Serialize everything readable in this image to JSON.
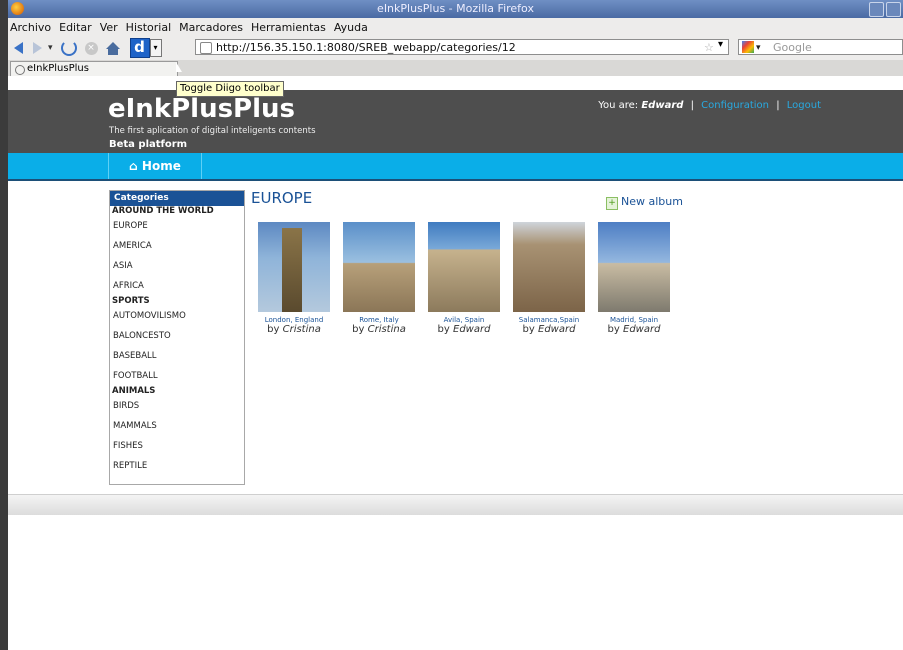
{
  "browser": {
    "title": "eInkPlusPlus - Mozilla Firefox",
    "menu": [
      "Archivo",
      "Editar",
      "Ver",
      "Historial",
      "Marcadores",
      "Herramientas",
      "Ayuda"
    ],
    "url": "http://156.35.150.1:8080/SREB_webapp/categories/12",
    "search_placeholder": "Google",
    "tab_title": "eInkPlusPlus",
    "tooltip": "Toggle Diigo toolbar"
  },
  "site": {
    "logo": "eInkPlusPlus",
    "tagline": "The first aplication of digital inteligents contents",
    "beta": "Beta platform",
    "user_prefix": "You are:",
    "user_name": "Edward",
    "config_label": "Configuration",
    "logout_label": "Logout",
    "nav_home": "Home"
  },
  "categories": {
    "heading": "Categories",
    "groups": [
      {
        "name": "AROUND THE WORLD",
        "items": [
          "EUROPE",
          "AMERICA",
          "ASIA",
          "AFRICA"
        ]
      },
      {
        "name": "SPORTS",
        "items": [
          "AUTOMOVILISMO",
          "BALONCESTO",
          "BASEBALL",
          "FOOTBALL"
        ]
      },
      {
        "name": "ANIMALS",
        "items": [
          "BIRDS",
          "MAMMALS",
          "FISHES",
          "REPTILE"
        ]
      }
    ]
  },
  "main": {
    "title": "EUROPE",
    "new_album": "New album",
    "by_prefix": "by",
    "albums": [
      {
        "place": "London, England",
        "author": "Cristina"
      },
      {
        "place": "Rome, Italy",
        "author": "Cristina"
      },
      {
        "place": "Avila, Spain",
        "author": "Edward"
      },
      {
        "place": "Salamanca,Spain",
        "author": "Edward"
      },
      {
        "place": "Madrid, Spain",
        "author": "Edward"
      }
    ]
  }
}
